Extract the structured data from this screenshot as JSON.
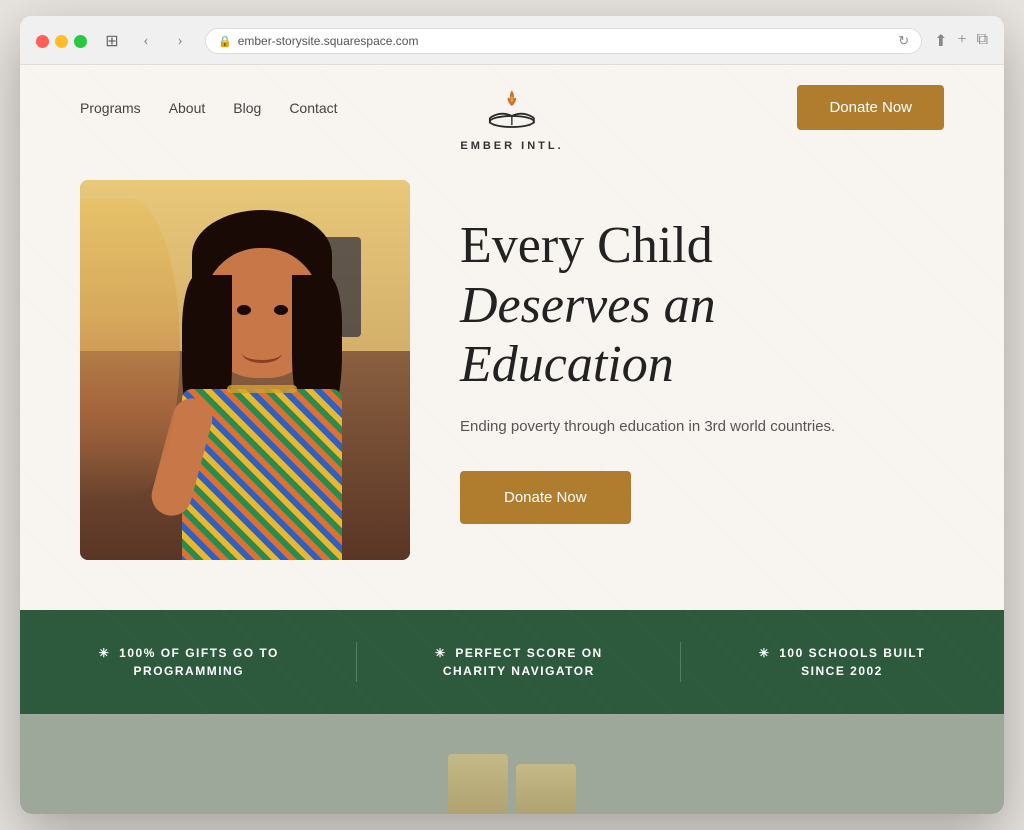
{
  "browser": {
    "url": "ember-storysite.squarespace.com",
    "back_label": "‹",
    "forward_label": "›",
    "refresh_label": "↻",
    "share_label": "⬆",
    "new_tab_label": "+",
    "copy_label": "⧉"
  },
  "nav": {
    "programs": "Programs",
    "about": "About",
    "blog": "Blog",
    "contact": "Contact"
  },
  "logo": {
    "name": "EMBER INTL.",
    "tagline": "EMBER INTL."
  },
  "header": {
    "donate_button": "Donate Now"
  },
  "hero": {
    "title_line1": "Every Child",
    "title_line2": "Deserves an",
    "title_line3": "Education",
    "subtitle": "Ending poverty through education in 3rd world countries.",
    "donate_button": "Donate Now"
  },
  "stats": [
    {
      "icon": "✳",
      "text": "100% OF GIFTS GO TO\nPROGRAMMING"
    },
    {
      "icon": "✳",
      "text": "PERFECT SCORE ON\nCHARITY NAVIGATOR"
    },
    {
      "icon": "✳",
      "text": "100 SCHOOLS BUILT\nSINCE 2002"
    }
  ],
  "colors": {
    "donate_button": "#b07d2f",
    "stats_bg": "#2d5a3d",
    "page_bg": "#f8f4ef",
    "bottom_bg": "#9ea89a"
  }
}
